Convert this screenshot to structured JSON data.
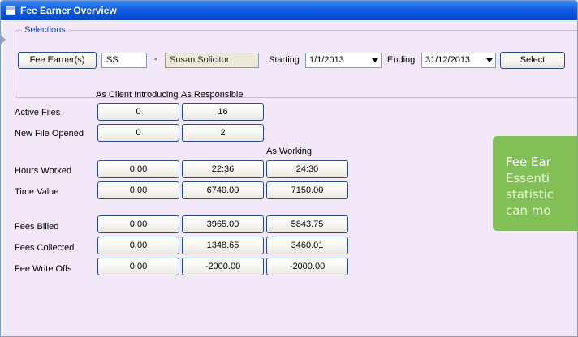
{
  "window": {
    "title": "Fee Earner Overview"
  },
  "selections": {
    "legend": "Selections",
    "fee_earner_button": "Fee Earner(s)",
    "code": "SS",
    "separator": "-",
    "name": "Susan Solicitor",
    "starting_label": "Starting",
    "starting_value": "1/1/2013",
    "ending_label": "Ending",
    "ending_value": "31/12/2013",
    "select_button": "Select"
  },
  "headers": {
    "client_introducing": "As Client Introducing",
    "responsible": "As Responsible",
    "working": "As Working"
  },
  "rows": [
    {
      "label": "Active Files",
      "values": [
        "0",
        "16"
      ]
    },
    {
      "label": "New File Opened",
      "values": [
        "0",
        "2"
      ]
    },
    {
      "label": "Hours Worked",
      "values": [
        "0:00",
        "22:36",
        "24:30"
      ]
    },
    {
      "label": "Time Value",
      "values": [
        "0.00",
        "6740.00",
        "7150.00"
      ]
    },
    {
      "label": "Fees Billed",
      "values": [
        "0.00",
        "3965.00",
        "5843.75"
      ]
    },
    {
      "label": "Fees Collected",
      "values": [
        "0.00",
        "1348.65",
        "3460.01"
      ]
    },
    {
      "label": "Fee Write Offs",
      "values": [
        "0.00",
        "-2000.00",
        "-2000.00"
      ]
    }
  ],
  "callout": {
    "line1": "Fee Ear",
    "line2": "Essenti",
    "line3": "statistic",
    "line4": "can mo",
    "background": "#82bf56"
  },
  "colors": {
    "titlebar": "#0a52d8",
    "client_bg": "#f2e8f7",
    "legend_text": "#1e40c8"
  }
}
